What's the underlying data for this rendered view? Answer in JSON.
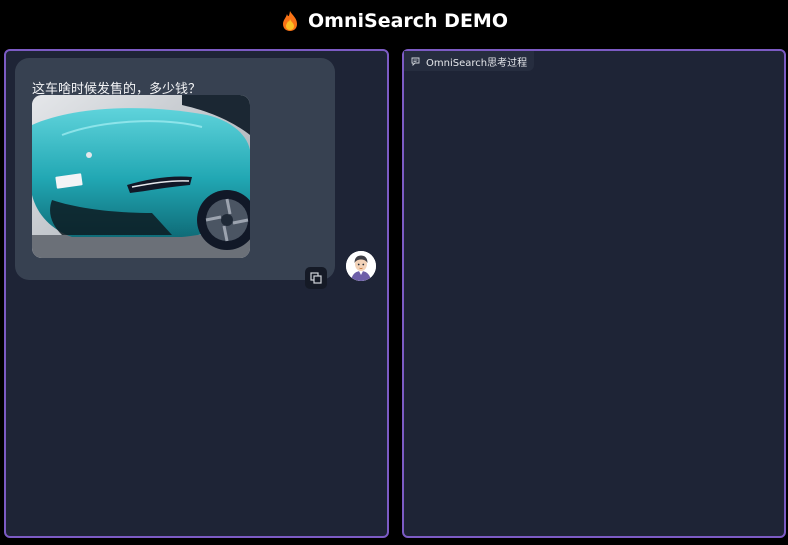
{
  "app": {
    "title": "OmniSearch DEMO",
    "icon": "flame-icon"
  },
  "chat": {
    "user_message": "这车啥时候发售的，多少钱？",
    "image_alt": "teal sports car photo",
    "copy_icon": "copy-icon",
    "avatar_icon": "user-avatar"
  },
  "thinking_panel": {
    "label": "OmniSearch思考过程",
    "icon": "chat-bubble-icon"
  },
  "colors": {
    "background": "#000000",
    "panel": "#1e2436",
    "panel_border": "#7c5bc4",
    "bubble": "#374151",
    "car_body": "#2bb5c0"
  }
}
